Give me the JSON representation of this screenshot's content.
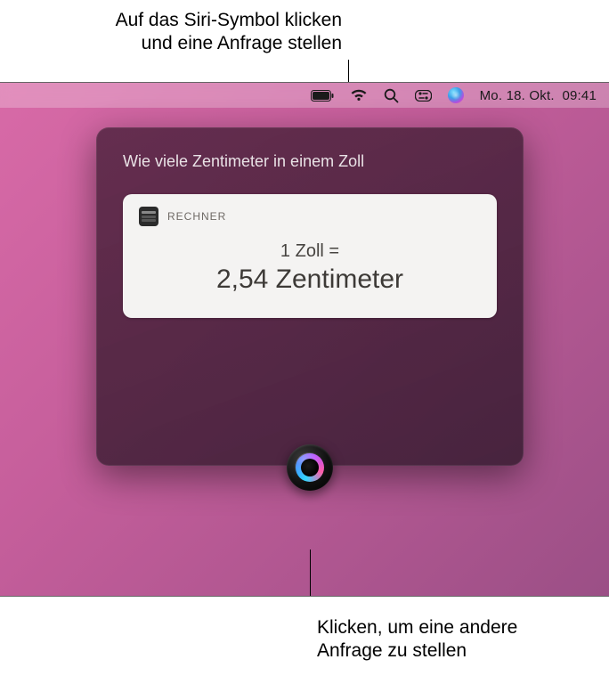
{
  "callouts": {
    "top_line1": "Auf das Siri-Symbol klicken",
    "top_line2": "und eine Anfrage stellen",
    "bottom_line1": "Klicken, um eine andere",
    "bottom_line2": "Anfrage zu stellen"
  },
  "menubar": {
    "date": "Mo. 18. Okt.",
    "time": "09:41"
  },
  "siri": {
    "query": "Wie viele Zentimeter in einem Zoll",
    "card_source": "RECHNER",
    "formula": "1 Zoll =",
    "result": "2,54 Zentimeter"
  }
}
